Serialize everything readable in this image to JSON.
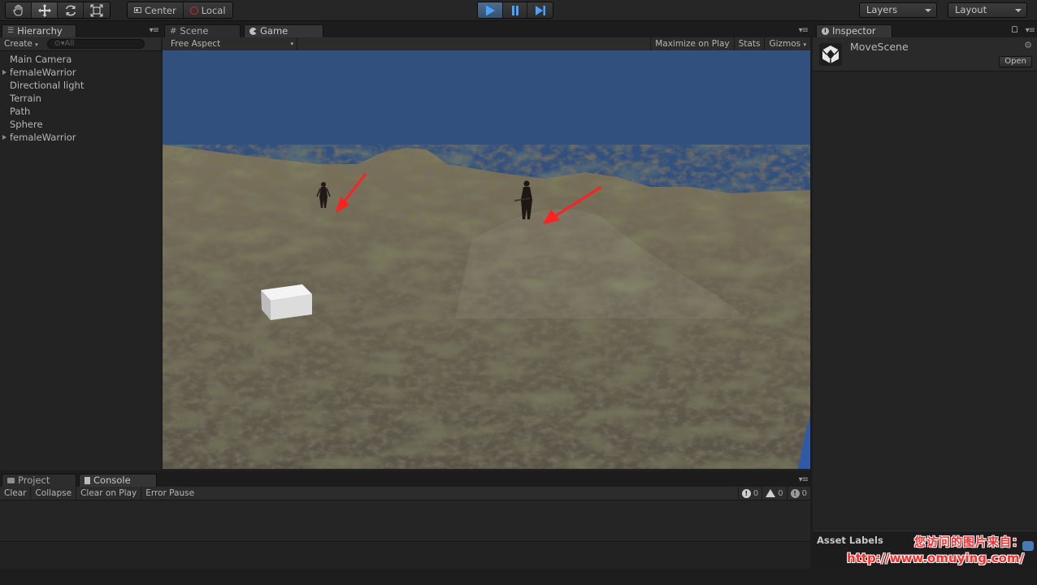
{
  "toolbar": {
    "tools": [
      {
        "name": "hand-tool",
        "icon": "hand-icon"
      },
      {
        "name": "move-tool",
        "icon": "move-arrows-icon"
      },
      {
        "name": "rotate-tool",
        "icon": "rotate-icon"
      },
      {
        "name": "scale-tool",
        "icon": "scale-icon"
      }
    ],
    "pivot_label": "Center",
    "space_label": "Local",
    "layers_label": "Layers",
    "layout_label": "Layout"
  },
  "hierarchy": {
    "tab": "Hierarchy",
    "create_label": "Create",
    "search_placeholder": "All",
    "items": [
      {
        "label": "Main Camera",
        "foldout": false
      },
      {
        "label": "femaleWarrior",
        "foldout": true
      },
      {
        "label": "Directional light",
        "foldout": false
      },
      {
        "label": "Terrain",
        "foldout": false
      },
      {
        "label": "Path",
        "foldout": false
      },
      {
        "label": "Sphere",
        "foldout": false
      },
      {
        "label": "femaleWarrior",
        "foldout": true
      }
    ]
  },
  "game": {
    "tabs": [
      "Scene",
      "Game"
    ],
    "aspect_label": "Free Aspect",
    "maximize_label": "Maximize on Play",
    "stats_label": "Stats",
    "gizmos_label": "Gizmos",
    "colors": {
      "sky": "#32507e",
      "terrain": "#6b6350",
      "cube": "#e9e9e9",
      "arrow": "#ff2020"
    }
  },
  "inspector": {
    "tab": "Inspector",
    "asset_name": "MoveScene",
    "open_label": "Open",
    "asset_labels": "Asset Labels"
  },
  "console": {
    "tabs": [
      "Project",
      "Console"
    ],
    "buttons": [
      "Clear",
      "Collapse",
      "Clear on Play",
      "Error Pause"
    ],
    "counts": {
      "messages": "0",
      "warnings": "0",
      "errors": "0"
    }
  },
  "watermark": {
    "line1": "您访问的图片来自：",
    "line2": "http://www.omuying.com/"
  }
}
